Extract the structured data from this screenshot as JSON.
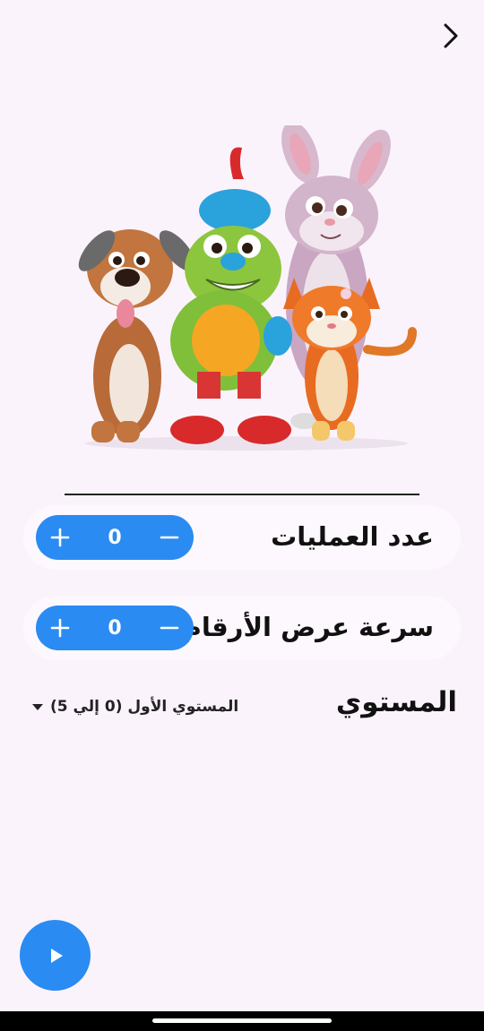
{
  "settings": {
    "operations_count": {
      "label": "عدد العمليات",
      "value": "0"
    },
    "display_speed": {
      "label": "سرعة عرض الأرقام",
      "value": "0"
    },
    "level": {
      "label": "المستوي",
      "selected": "المستوي الأول (0 إلي 5)"
    }
  },
  "icons": {
    "back": "chevron-right-icon",
    "plus": "plus-icon",
    "minus": "minus-icon",
    "play": "play-icon",
    "dropdown": "caret-down-icon"
  },
  "colors": {
    "accent": "#2a8bf2",
    "background": "#fbf3fc"
  }
}
